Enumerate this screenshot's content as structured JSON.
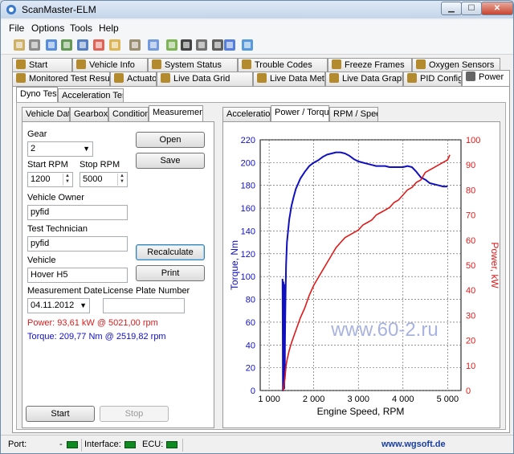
{
  "window": {
    "title": "ScanMaster-ELM"
  },
  "menu": [
    "File",
    "Options",
    "Tools",
    "Help"
  ],
  "toolbar_icons": [
    "connect-icon",
    "settings-icon",
    "open-icon",
    "grid-icon",
    "table-icon",
    "chart-icon",
    "dollar-icon",
    "clipboard-icon",
    "chat-icon",
    "battery-icon",
    "terminal-icon",
    "filter-icon",
    "gauge-icon",
    "info-icon",
    "help-icon"
  ],
  "main_tabs_top": [
    {
      "label": "Start",
      "icon": "start-icon"
    },
    {
      "label": "Vehicle Info",
      "icon": "info-icon"
    },
    {
      "label": "System Status",
      "icon": "status-icon"
    },
    {
      "label": "Trouble Codes",
      "icon": "warning-icon"
    },
    {
      "label": "Freeze Frames",
      "icon": "freeze-icon"
    },
    {
      "label": "Oxygen Sensors",
      "icon": "oxygen-icon"
    }
  ],
  "main_tabs_bottom": [
    {
      "label": "Monitored Test Results",
      "icon": "test-icon"
    },
    {
      "label": "Actuator",
      "icon": "actuator-icon"
    },
    {
      "label": "Live Data Grid",
      "icon": "grid-icon"
    },
    {
      "label": "Live Data Meter",
      "icon": "meter-icon"
    },
    {
      "label": "Live Data Graph",
      "icon": "graph-icon"
    },
    {
      "label": "PID Config",
      "icon": "config-icon"
    },
    {
      "label": "Power",
      "icon": "power-icon",
      "active": true
    }
  ],
  "dyno_tabs": [
    "Dyno Test",
    "Acceleration Test"
  ],
  "left_tabs": [
    "Vehicle Data",
    "Gearbox",
    "Conditions",
    "Measurement"
  ],
  "form": {
    "gear_label": "Gear",
    "gear_value": "2",
    "start_rpm_label": "Start RPM",
    "start_rpm_value": "1200",
    "stop_rpm_label": "Stop RPM",
    "stop_rpm_value": "5000",
    "owner_label": "Vehicle Owner",
    "owner_value": "pyfid",
    "technician_label": "Test Technician",
    "technician_value": "pyfid",
    "vehicle_label": "Vehicle",
    "vehicle_value": "Hover H5",
    "date_label": "Measurement Date",
    "date_value": "04.11.2012",
    "plate_label": "License Plate Number",
    "plate_value": "",
    "power_result": "Power: 93,61 kW @ 5021,00 rpm",
    "torque_result": "Torque: 209,77 Nm @ 2519,82 rpm"
  },
  "buttons": {
    "open": "Open",
    "save": "Save",
    "recalculate": "Recalculate",
    "print": "Print",
    "start": "Start",
    "stop": "Stop"
  },
  "chart_tabs": [
    "Acceleration",
    "Power / Torque",
    "RPM / Speed"
  ],
  "colors": {
    "torque": "#1010c0",
    "power": "#e01a1a",
    "watermark": "#9aa6da"
  },
  "watermark": "www.60-2.ru",
  "statusbar": {
    "port_label": "Port:",
    "port_value": "-",
    "interface_label": "Interface:",
    "ecu_label": "ECU:",
    "link": "www.wgsoft.de"
  },
  "chart_data": {
    "type": "line",
    "xlabel": "Engine Speed, RPM",
    "ylabel_left": "Torque, Nm",
    "ylabel_right": "Power, kW",
    "xlim": [
      800,
      5300
    ],
    "ylim_left": [
      0,
      220
    ],
    "ylim_right": [
      0,
      100
    ],
    "x_ticks": [
      1000,
      2000,
      3000,
      4000,
      5000
    ],
    "x_tick_labels": [
      "1 000",
      "2 000",
      "3 000",
      "4 000",
      "5 000"
    ],
    "y_left_ticks": [
      0,
      20,
      40,
      60,
      80,
      100,
      120,
      140,
      160,
      180,
      200,
      220
    ],
    "y_right_ticks": [
      0,
      10,
      20,
      30,
      40,
      50,
      60,
      70,
      80,
      90,
      100
    ],
    "grid": true,
    "series": [
      {
        "name": "Torque, Nm",
        "axis": "left",
        "x": [
          1300,
          1310,
          1320,
          1330,
          1335,
          1340,
          1345,
          1350,
          1355,
          1360,
          1370,
          1380,
          1400,
          1450,
          1500,
          1550,
          1600,
          1700,
          1800,
          1900,
          2000,
          2100,
          2200,
          2300,
          2400,
          2500,
          2600,
          2700,
          2800,
          2900,
          3000,
          3100,
          3200,
          3300,
          3400,
          3500,
          3600,
          3700,
          3800,
          3900,
          4000,
          4100,
          4200,
          4300,
          4400,
          4500,
          4600,
          4700,
          4800,
          4900,
          5000
        ],
        "y": [
          98,
          0,
          95,
          5,
          93,
          2,
          90,
          10,
          40,
          60,
          90,
          110,
          130,
          150,
          162,
          170,
          177,
          186,
          192,
          197,
          200,
          202,
          205,
          207,
          208,
          209,
          209,
          208,
          206,
          203,
          201,
          200,
          199,
          198,
          197,
          197,
          197,
          196,
          196,
          196,
          196,
          197,
          196,
          192,
          187,
          185,
          182,
          181,
          180,
          179,
          179
        ]
      },
      {
        "name": "Power, kW",
        "axis": "right",
        "x": [
          1320,
          1340,
          1360,
          1380,
          1400,
          1450,
          1500,
          1600,
          1700,
          1800,
          1900,
          2000,
          2100,
          2200,
          2300,
          2400,
          2500,
          2600,
          2700,
          2800,
          2900,
          3000,
          3100,
          3200,
          3300,
          3400,
          3500,
          3600,
          3700,
          3800,
          3900,
          4000,
          4100,
          4200,
          4300,
          4400,
          4500,
          4600,
          4700,
          4800,
          4900,
          5000,
          5050
        ],
        "y": [
          0,
          3,
          6,
          10,
          12,
          16,
          19,
          24,
          29,
          33,
          38,
          42,
          45,
          48,
          51,
          54,
          57,
          59,
          61,
          62,
          63,
          64,
          66,
          67,
          68,
          70,
          71,
          72,
          73,
          75,
          76,
          78,
          80,
          81,
          83,
          84,
          87,
          88,
          89,
          90,
          91,
          92,
          94
        ]
      }
    ]
  }
}
